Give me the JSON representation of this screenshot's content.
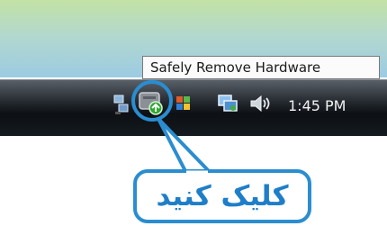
{
  "tooltip": {
    "text": "Safely Remove Hardware"
  },
  "taskbar": {
    "clock": "1:45 PM",
    "tray_icons": [
      {
        "name": "network-icon"
      },
      {
        "name": "safely-remove-hardware-icon"
      },
      {
        "name": "windows-flag-icon"
      },
      {
        "name": "network-connection-icon"
      },
      {
        "name": "volume-icon"
      }
    ]
  },
  "callout": {
    "text": "کلیک کنید"
  },
  "colors": {
    "highlight": "#2a8dd0",
    "callout_text": "#1f7ec8",
    "taskbar": "#141a20"
  }
}
